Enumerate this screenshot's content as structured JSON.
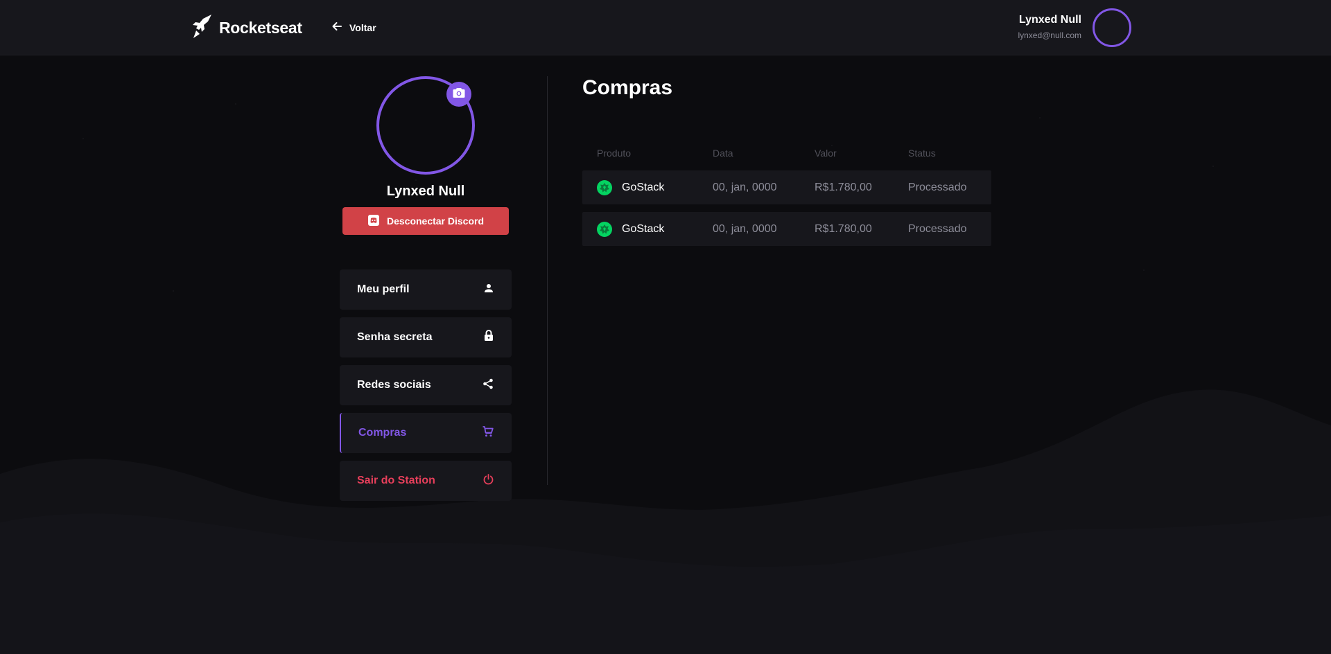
{
  "header": {
    "logo_text": "Rocketseat",
    "back_label": "Voltar",
    "user_name": "Lynxed Null",
    "user_email": "lynxed@null.com"
  },
  "profile": {
    "name": "Lynxed Null",
    "discord_button": "Desconectar Discord"
  },
  "menu": {
    "items": [
      {
        "label": "Meu perfil",
        "icon": "person-icon"
      },
      {
        "label": "Senha secreta",
        "icon": "lock-icon"
      },
      {
        "label": "Redes sociais",
        "icon": "share-icon"
      },
      {
        "label": "Compras",
        "icon": "cart-icon",
        "active": true
      },
      {
        "label": "Sair do Station",
        "icon": "power-icon",
        "danger": true
      }
    ]
  },
  "purchases": {
    "title": "Compras",
    "columns": [
      "Produto",
      "Data",
      "Valor",
      "Status"
    ],
    "rows": [
      {
        "product": "GoStack",
        "date": "00, jan, 0000",
        "value": "R$1.780,00",
        "status": "Processado"
      },
      {
        "product": "GoStack",
        "date": "00, jan, 0000",
        "value": "R$1.780,00",
        "status": "Processado"
      }
    ]
  },
  "colors": {
    "accent": "#8257e6",
    "danger": "#e83f5b",
    "discord": "#d14247",
    "product_icon": "#04d361"
  }
}
